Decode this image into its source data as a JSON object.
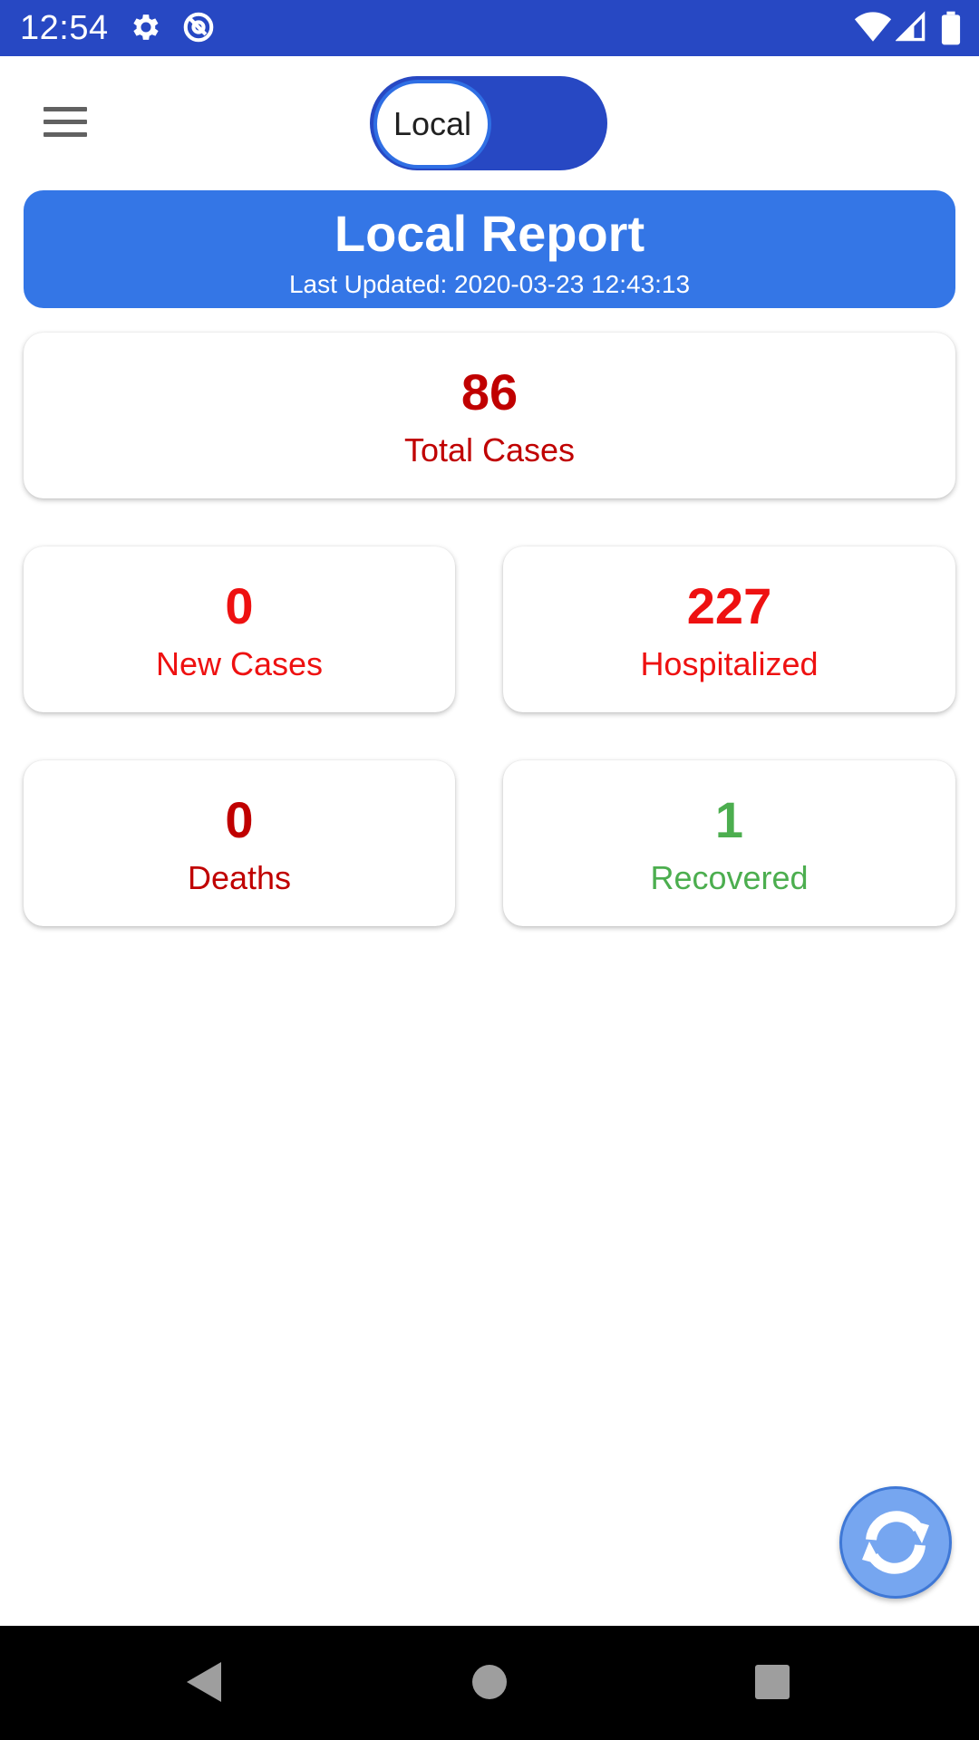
{
  "status_bar": {
    "time": "12:54",
    "icons": [
      "gear-icon",
      "at-sign-icon",
      "wifi-icon",
      "signal-icon",
      "battery-icon"
    ]
  },
  "app_bar": {
    "menu_icon": "hamburger-menu-icon",
    "toggle_label": "Local"
  },
  "header": {
    "title": "Local Report",
    "last_updated": "Last Updated: 2020-03-23 12:43:13"
  },
  "stats": {
    "total": {
      "value": "86",
      "label": "Total Cases",
      "color": "#c00000"
    },
    "new_cases": {
      "value": "0",
      "label": "New Cases",
      "color": "#ee1111"
    },
    "hospitalized": {
      "value": "227",
      "label": "Hospitalized",
      "color": "#ee1111"
    },
    "deaths": {
      "value": "0",
      "label": "Deaths",
      "color": "#c00000"
    },
    "recovered": {
      "value": "1",
      "label": "Recovered",
      "color": "#4cae4f"
    }
  },
  "fab": {
    "icon": "refresh-icon"
  },
  "nav_bar": {
    "icons": [
      "back-triangle-icon",
      "home-circle-icon",
      "recents-square-icon"
    ]
  },
  "colors": {
    "status_bar": "#2748c3",
    "toggle_track": "#2748c3",
    "banner": "#3476e6"
  }
}
